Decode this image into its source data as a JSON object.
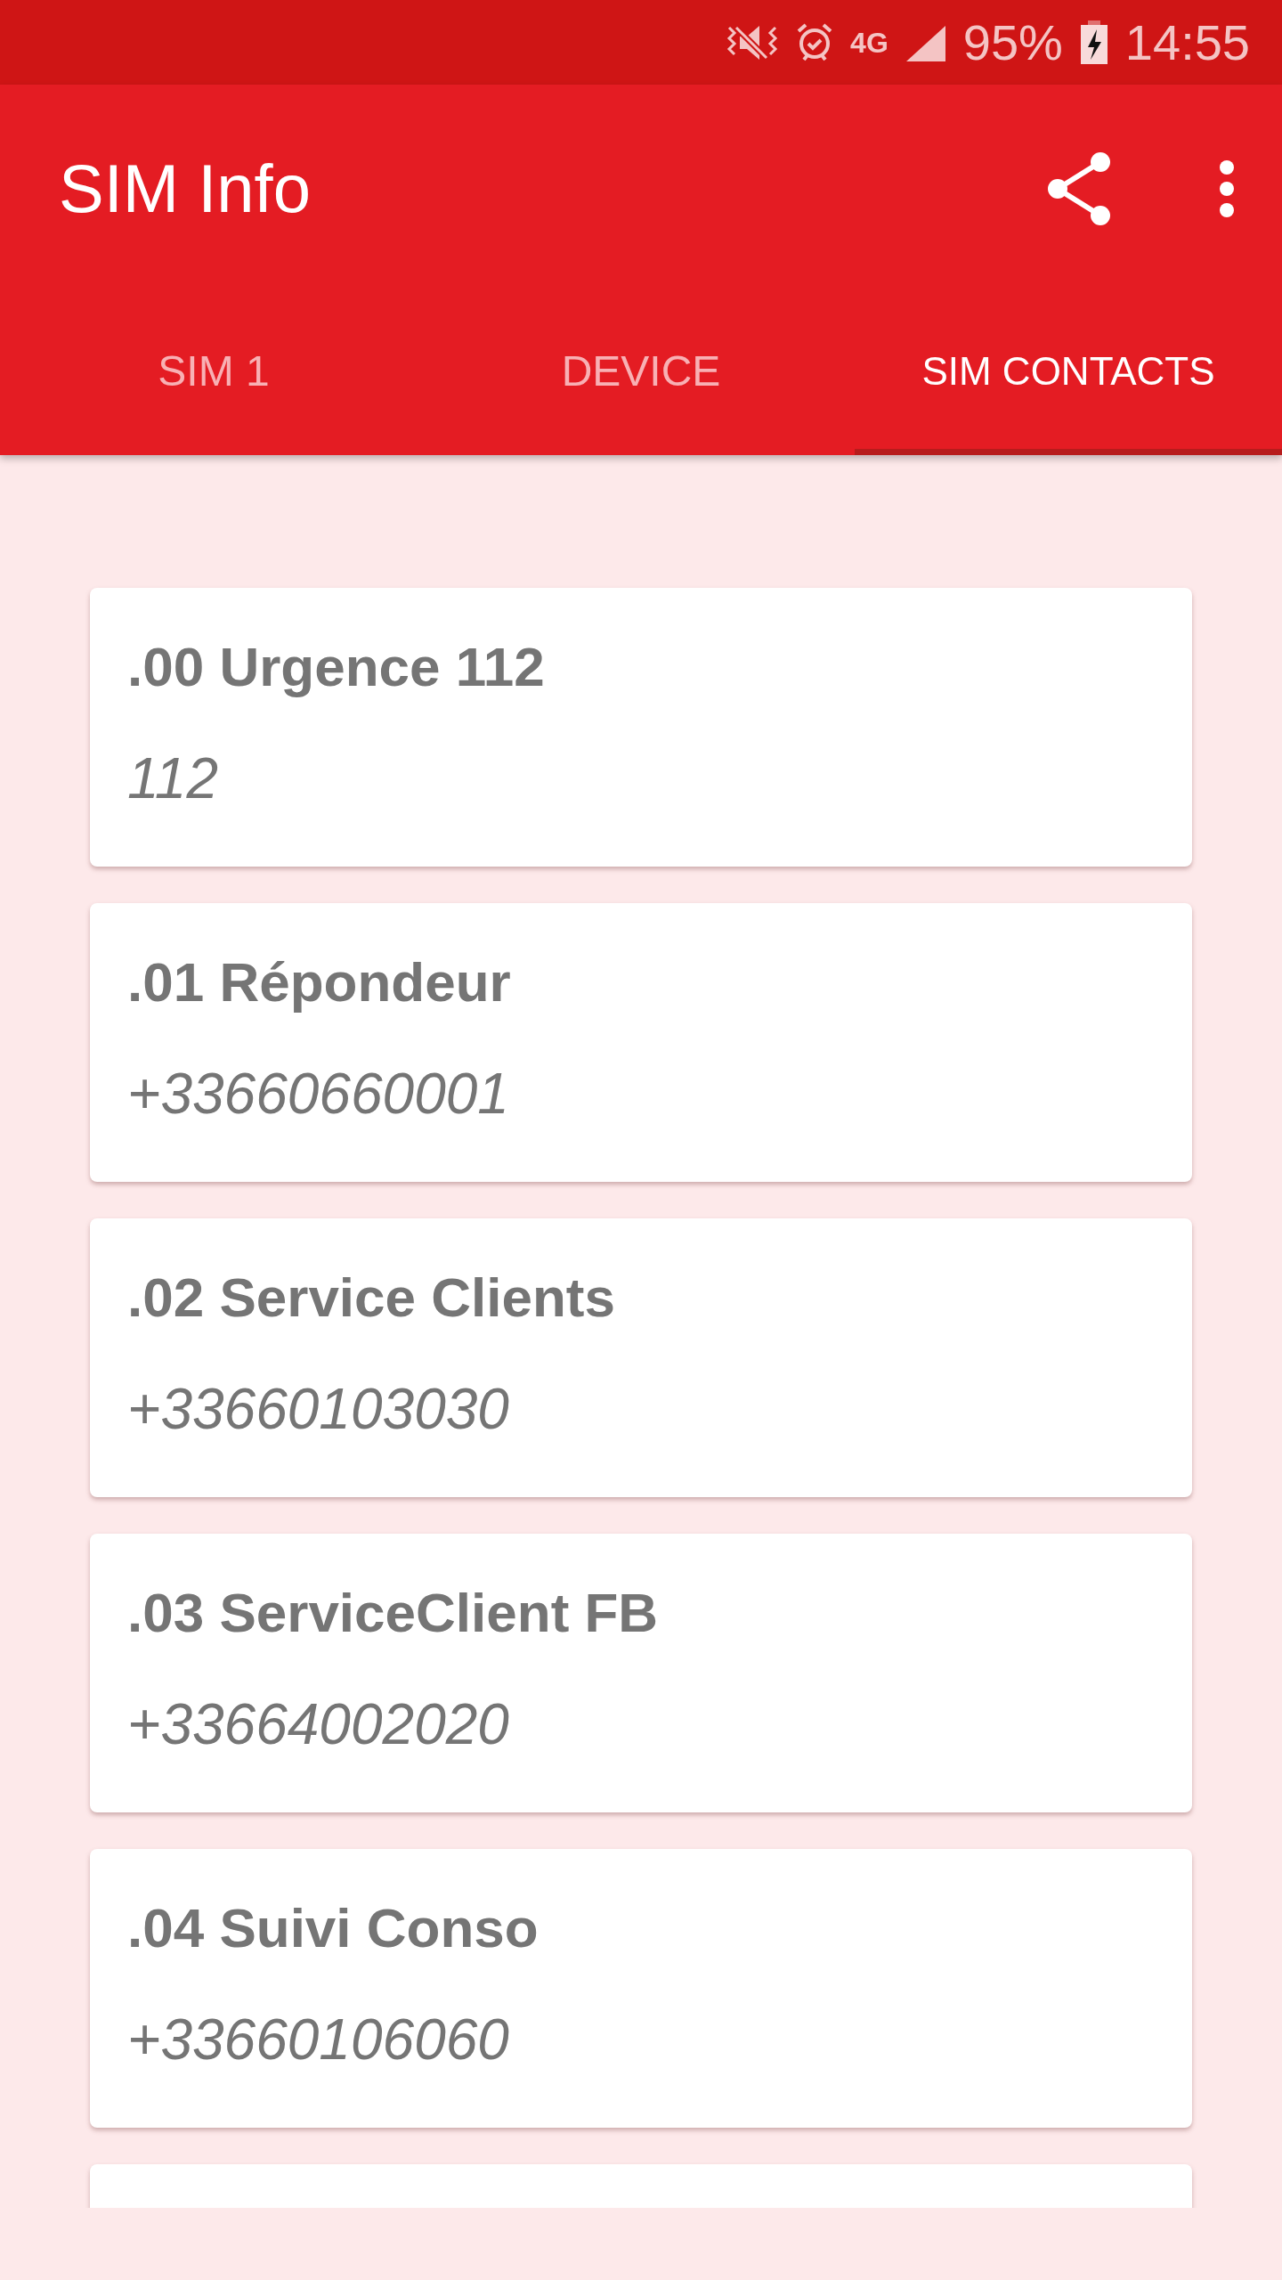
{
  "status_bar": {
    "network_type": "4G",
    "battery": "95%",
    "time": "14:55"
  },
  "app_bar": {
    "title": "SIM Info"
  },
  "tabs": [
    {
      "label": "SIM 1",
      "selected": false
    },
    {
      "label": "DEVICE",
      "selected": false
    },
    {
      "label": "SIM CONTACTS",
      "selected": true
    }
  ],
  "contacts": [
    {
      "name": ".00 Urgence 112",
      "number": "112"
    },
    {
      "name": ".01 Répondeur",
      "number": "+33660660001"
    },
    {
      "name": ".02 Service Clients",
      "number": "+33660103030"
    },
    {
      "name": ".03 ServiceClient FB",
      "number": "+33664002020"
    },
    {
      "name": ".04 Suivi Conso",
      "number": "+33660106060"
    }
  ],
  "more_below": true
}
